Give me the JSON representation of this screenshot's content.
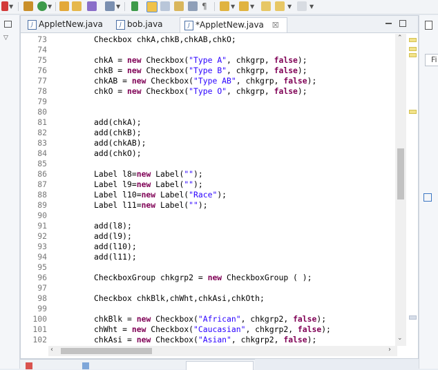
{
  "tabs": [
    {
      "label": "AppletNew.java"
    },
    {
      "label": "bob.java"
    },
    {
      "label": "*AppletNew.java",
      "close": "☒"
    }
  ],
  "right_panel": {
    "fragment": "Fi"
  },
  "code_lines": [
    {
      "n": "73",
      "s": [
        [
          "p",
          "Checkbox chkA,chkB,chkAB,chkO;"
        ]
      ]
    },
    {
      "n": "74",
      "s": []
    },
    {
      "n": "75",
      "s": [
        [
          "p",
          "chkA = "
        ],
        [
          "k",
          "new"
        ],
        [
          "p",
          " Checkbox("
        ],
        [
          "s",
          "\"Type A\""
        ],
        [
          "p",
          ", chkgrp, "
        ],
        [
          "k",
          "false"
        ],
        [
          "p",
          ");"
        ]
      ]
    },
    {
      "n": "76",
      "s": [
        [
          "p",
          "chkB = "
        ],
        [
          "k",
          "new"
        ],
        [
          "p",
          " Checkbox("
        ],
        [
          "s",
          "\"Type B\""
        ],
        [
          "p",
          ", chkgrp, "
        ],
        [
          "k",
          "false"
        ],
        [
          "p",
          ");"
        ]
      ]
    },
    {
      "n": "77",
      "s": [
        [
          "p",
          "chkAB = "
        ],
        [
          "k",
          "new"
        ],
        [
          "p",
          " Checkbox("
        ],
        [
          "s",
          "\"Type AB\""
        ],
        [
          "p",
          ", chkgrp, "
        ],
        [
          "k",
          "false"
        ],
        [
          "p",
          ");"
        ]
      ]
    },
    {
      "n": "78",
      "s": [
        [
          "p",
          "chkO = "
        ],
        [
          "k",
          "new"
        ],
        [
          "p",
          " Checkbox("
        ],
        [
          "s",
          "\"Type O\""
        ],
        [
          "p",
          ", chkgrp, "
        ],
        [
          "k",
          "false"
        ],
        [
          "p",
          ");"
        ]
      ]
    },
    {
      "n": "79",
      "s": []
    },
    {
      "n": "80",
      "s": []
    },
    {
      "n": "81",
      "s": [
        [
          "p",
          "add(chkA);"
        ]
      ]
    },
    {
      "n": "82",
      "s": [
        [
          "p",
          "add(chkB);"
        ]
      ]
    },
    {
      "n": "83",
      "s": [
        [
          "p",
          "add(chkAB);"
        ]
      ]
    },
    {
      "n": "84",
      "s": [
        [
          "p",
          "add(chkO);"
        ]
      ]
    },
    {
      "n": "85",
      "s": []
    },
    {
      "n": "86",
      "s": [
        [
          "p",
          "Label l8="
        ],
        [
          "k",
          "new"
        ],
        [
          "p",
          " Label("
        ],
        [
          "s",
          "\"\""
        ],
        [
          "p",
          ");"
        ]
      ]
    },
    {
      "n": "87",
      "s": [
        [
          "p",
          "Label l9="
        ],
        [
          "k",
          "new"
        ],
        [
          "p",
          " Label("
        ],
        [
          "s",
          "\"\""
        ],
        [
          "p",
          ");"
        ]
      ]
    },
    {
      "n": "88",
      "s": [
        [
          "p",
          "Label l10="
        ],
        [
          "k",
          "new"
        ],
        [
          "p",
          " Label("
        ],
        [
          "s",
          "\"Race\""
        ],
        [
          "p",
          ");"
        ]
      ]
    },
    {
      "n": "89",
      "s": [
        [
          "p",
          "Label l11="
        ],
        [
          "k",
          "new"
        ],
        [
          "p",
          " Label("
        ],
        [
          "s",
          "\"\""
        ],
        [
          "p",
          ");"
        ]
      ]
    },
    {
      "n": "90",
      "s": []
    },
    {
      "n": "91",
      "s": [
        [
          "p",
          "add(l8);"
        ]
      ]
    },
    {
      "n": "92",
      "s": [
        [
          "p",
          "add(l9);"
        ]
      ]
    },
    {
      "n": "93",
      "s": [
        [
          "p",
          "add(l10);"
        ]
      ]
    },
    {
      "n": "94",
      "s": [
        [
          "p",
          "add(l11);"
        ]
      ]
    },
    {
      "n": "95",
      "s": []
    },
    {
      "n": "96",
      "s": [
        [
          "p",
          "CheckboxGroup chkgrp2 = "
        ],
        [
          "k",
          "new"
        ],
        [
          "p",
          " CheckboxGroup ( );"
        ]
      ]
    },
    {
      "n": "97",
      "s": []
    },
    {
      "n": "98",
      "s": [
        [
          "p",
          "Checkbox chkBlk,chWht,chkAsi,chkOth;"
        ]
      ]
    },
    {
      "n": "99",
      "s": []
    },
    {
      "n": "100",
      "s": [
        [
          "p",
          "chkBlk = "
        ],
        [
          "k",
          "new"
        ],
        [
          "p",
          " Checkbox("
        ],
        [
          "s",
          "\"African\""
        ],
        [
          "p",
          ", chkgrp2, "
        ],
        [
          "k",
          "false"
        ],
        [
          "p",
          ");"
        ]
      ]
    },
    {
      "n": "101",
      "s": [
        [
          "p",
          "chWht = "
        ],
        [
          "k",
          "new"
        ],
        [
          "p",
          " Checkbox("
        ],
        [
          "s",
          "\"Caucasian\""
        ],
        [
          "p",
          ", chkgrp2, "
        ],
        [
          "k",
          "false"
        ],
        [
          "p",
          ");"
        ]
      ]
    },
    {
      "n": "102",
      "s": [
        [
          "p",
          "chkAsi = "
        ],
        [
          "k",
          "new"
        ],
        [
          "p",
          " Checkbox("
        ],
        [
          "s",
          "\"Asian\""
        ],
        [
          "p",
          ", chkgrp2, "
        ],
        [
          "k",
          "false"
        ],
        [
          "p",
          ");"
        ]
      ]
    }
  ],
  "colors": {
    "keyword": "#7f0055",
    "string": "#2a00ff",
    "line_number": "#787878",
    "editor_bg": "#ffffff"
  },
  "icons": [
    "minimize-icon",
    "maximize-icon",
    "close-icon",
    "java-file-icon",
    "scroll-up-icon",
    "scroll-down-icon",
    "scroll-left-icon",
    "scroll-right-icon"
  ]
}
